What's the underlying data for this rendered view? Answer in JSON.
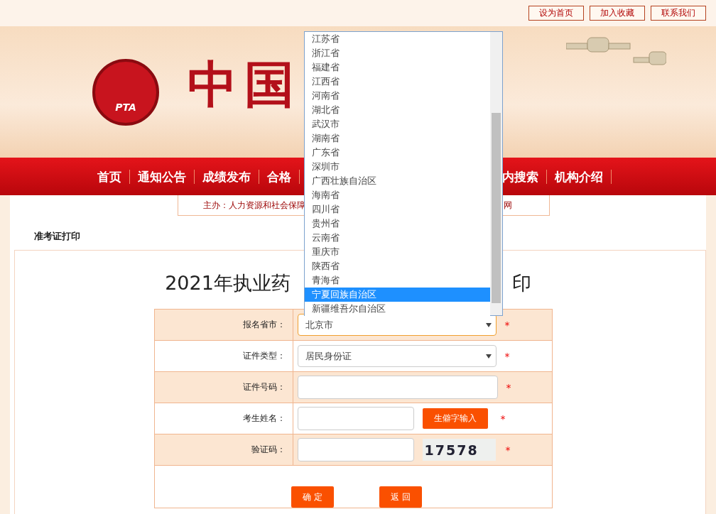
{
  "top_links": [
    "设为首页",
    "加入收藏",
    "联系我们"
  ],
  "banner": {
    "logo_text": "PTA",
    "title": "中国"
  },
  "nav": {
    "items_left": [
      "首页",
      "通知公告",
      "成绩发布",
      "合格"
    ],
    "items_right": [
      "内搜索",
      "机构介绍"
    ]
  },
  "subtitle": {
    "left": "主办：人力资源和社会保障",
    "right": "网"
  },
  "breadcrumb": "准考证打印",
  "page_title": {
    "left": "2021年执业药",
    "right": "印"
  },
  "form": {
    "rows": [
      {
        "label": "报名省市：",
        "kind": "select",
        "value": "北京市",
        "focused": true,
        "required_mark": "*"
      },
      {
        "label": "证件类型：",
        "kind": "select",
        "value": "居民身份证",
        "focused": false,
        "required_mark": "*"
      },
      {
        "label": "证件号码：",
        "kind": "input",
        "required_mark": "*"
      },
      {
        "label": "考生姓名：",
        "kind": "input_button",
        "button": "生僻字输入",
        "required_mark": "*"
      },
      {
        "label": "验证码：",
        "kind": "captcha",
        "captcha": "17578",
        "required_mark": "*"
      }
    ],
    "buttons": [
      "确 定",
      "返 回"
    ]
  },
  "dropdown": {
    "options": [
      {
        "label": "江苏省",
        "selected": false
      },
      {
        "label": "浙江省",
        "selected": false
      },
      {
        "label": "福建省",
        "selected": false
      },
      {
        "label": "江西省",
        "selected": false
      },
      {
        "label": "河南省",
        "selected": false
      },
      {
        "label": "湖北省",
        "selected": false
      },
      {
        "label": "武汉市",
        "selected": false
      },
      {
        "label": "湖南省",
        "selected": false
      },
      {
        "label": "广东省",
        "selected": false
      },
      {
        "label": "深圳市",
        "selected": false
      },
      {
        "label": "广西壮族自治区",
        "selected": false
      },
      {
        "label": "海南省",
        "selected": false
      },
      {
        "label": "四川省",
        "selected": false
      },
      {
        "label": "贵州省",
        "selected": false
      },
      {
        "label": "云南省",
        "selected": false
      },
      {
        "label": "重庆市",
        "selected": false
      },
      {
        "label": "陕西省",
        "selected": false
      },
      {
        "label": "青海省",
        "selected": false
      },
      {
        "label": "宁夏回族自治区",
        "selected": true
      },
      {
        "label": "新疆维吾尔自治区",
        "selected": false
      }
    ]
  }
}
